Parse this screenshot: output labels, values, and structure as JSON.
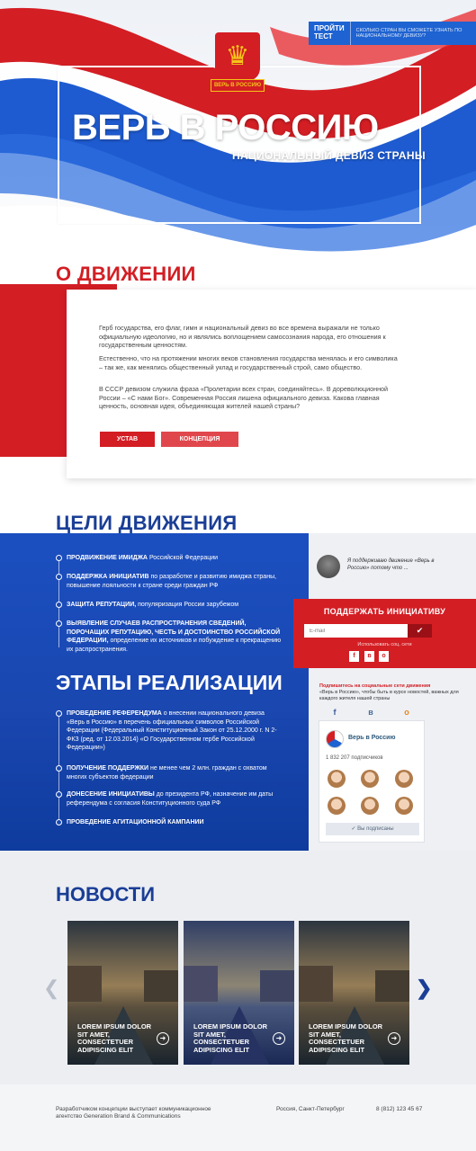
{
  "hero": {
    "title": "ВЕРЬ В РОССИЮ",
    "subtitle": "НАЦИОНАЛЬНЫЙ ДЕВИЗ СТРАНЫ",
    "emblem_ribbon": "ВЕРЬ В РОССИЮ",
    "test_button": "ПРОЙТИ ТЕСТ",
    "test_text": "Сколько стран вы сможете узнать по национальному девизу?"
  },
  "about": {
    "title": "О ДВИЖЕНИИ",
    "paragraphs": [
      "Герб государства, его флаг, гимн и национальный девиз во все времена выражали не только официальную идеологию, но и являлись воплощением самосознания народа, его отношения к государственным ценностям.",
      "Естественно, что на протяжении многих веков становления государства менялась и его символика – так же, как менялись общественный уклад и государственный строй, само общество.",
      "В СССР девизом служила фраза «Пролетарии всех стран, соединяйтесь». В дореволюционной России – «С нами Бог». Современная Россия лишена официального девиза. Какова главная ценность, основная идея, объединяющая жителей нашей страны?"
    ],
    "btn_charter": "УСТАВ",
    "btn_concept": "КОНЦЕПЦИЯ"
  },
  "goals": {
    "title": "ЦЕЛИ ДВИЖЕНИЯ",
    "items": [
      {
        "bold": "ПРОДВИЖЕНИЕ ИМИДЖА",
        "text": " Российской Федерации"
      },
      {
        "bold": "ПОДДЕРЖКА ИНИЦИАТИВ",
        "text": " по разработке и развитию имиджа страны, повышение лояльности к стране среди граждан РФ"
      },
      {
        "bold": "ЗАЩИТА РЕПУТАЦИИ,",
        "text": " популяризация России зарубежом"
      },
      {
        "bold": "ВЫЯВЛЕНИЕ СЛУЧАЕВ РАСПРОСТРАНЕНИЯ СВЕДЕНИЙ, ПОРОЧАЩИХ РЕПУТАЦИЮ, ЧЕСТЬ И ДОСТОИНСТВО РОССИЙСКОЙ ФЕДЕРАЦИИ,",
        "text": " определение их источников и побуждение к прекращению их распространения."
      }
    ]
  },
  "stages": {
    "title": "ЭТАПЫ РЕАЛИЗАЦИИ",
    "items": [
      {
        "bold": "ПРОВЕДЕНИЕ РЕФЕРЕНДУМА",
        "text": " о внесении национального девиза «Верь в Россию» в перечень официальных символов Российской Федерации (Федеральный Конституционный Закон от 25.12.2000 г. N 2-ФКЗ (ред. от 12.03.2014) «О Государственном гербе Российской Федерации»)"
      },
      {
        "bold": "ПОЛУЧЕНИЕ ПОДДЕРЖКИ",
        "text": " не менее чем 2 млн. граждан с охватом многих субъектов федерации"
      },
      {
        "bold": "ДОНЕСЕНИЕ ИНИЦИАТИВЫ",
        "text": " до президента РФ, назначение им даты референдума с согласия Конституционного суда РФ"
      },
      {
        "bold": "ПРОВЕДЕНИЕ АГИТАЦИОННОЙ КАМПАНИИ",
        "text": ""
      }
    ]
  },
  "sidebar": {
    "quote": "Я поддерживаю движение «Верь в Россию» потому что ...",
    "support_title": "ПОДДЕРЖАТЬ ИНИЦИАТИВУ",
    "email_placeholder": "E-mail",
    "social_hint": "Использовать соц. сети",
    "subscribe_bold": "Подпишитесь на социальные сети движения",
    "subscribe_text": "«Верь в Россию», чтобы быть в курсе новостей, важных для каждого жителя нашей страны",
    "vk_name": "Верь в Россию",
    "vk_count": "1 832 207 подписчиков",
    "vk_button": "✓ Вы подписаны"
  },
  "news": {
    "title": "НОВОСТИ",
    "items": [
      {
        "caption": "LOREM IPSUM DOLOR SIT AMET, CONSECTETUER ADIPISCING ELIT"
      },
      {
        "caption": "LOREM IPSUM DOLOR SIT AMET, CONSECTETUER ADIPISCING ELIT"
      },
      {
        "caption": "LOREM IPSUM DOLOR SIT AMET, CONSECTETUER ADIPISCING ELIT"
      }
    ]
  },
  "footer": {
    "developer": "Разработчиком концепции выступает коммуникационное агентство Generation Brand & Communications",
    "city": "Россия, Санкт-Петербург",
    "phone": "8 (812) 123 45 67"
  },
  "colors": {
    "red": "#d31e24",
    "blue": "#1a47b0",
    "dark_blue": "#1a3e96"
  },
  "icons": [
    "coat-of-arms-icon",
    "check-icon",
    "facebook-icon",
    "vk-icon",
    "odnoklassniki-icon",
    "arrow-right-icon",
    "chevron-left-icon",
    "chevron-right-icon"
  ]
}
